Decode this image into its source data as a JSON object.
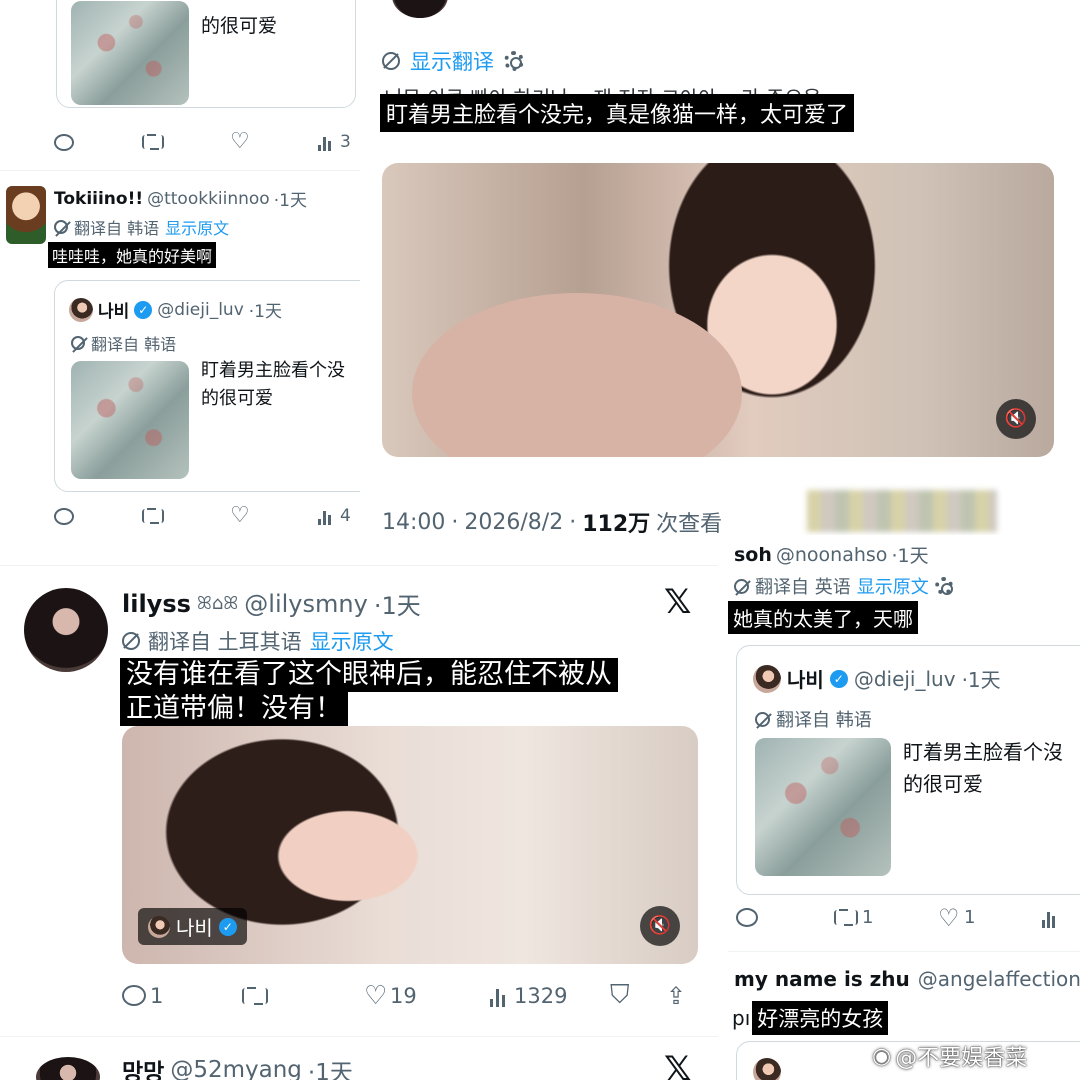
{
  "top_left": {
    "partial_text": "的很可爱",
    "second_tweet": {
      "name": "Tokiiino!!",
      "handle": "@ttookkiinnoo",
      "time": "·1天",
      "translated_from": "翻译自 韩语",
      "show_original": "显示原文",
      "text": "哇哇哇，她真的好美啊",
      "quote": {
        "name": "나비",
        "handle": "@dieji_luv",
        "time": "·1天",
        "translated_from": "翻译自 韩语",
        "text_line1": "盯着男主脸看个没",
        "text_line2": "的很可爱"
      }
    }
  },
  "main_tweet": {
    "show_translation": "显示翻译",
    "garbled_original": "너무 이쿠 빠아 하기나ㅠ 재 저자 그아아ㅠ 라 주으음",
    "translated_text": "盯着男主脸看个没完，真是像猫一样，太可爱了",
    "time": "14:00",
    "date": "2026/8/2",
    "views_count": "112万",
    "views_label": "次查看"
  },
  "lilyss_tweet": {
    "name": "lilyss",
    "name_deco": "ꕤ⌂ꕤ",
    "handle": "@lilysmny",
    "time": "·1天",
    "translated_from": "翻译自 土耳其语",
    "show_original": "显示原文",
    "text_line1": "没有谁在看了这个眼神后，能忍住不被从",
    "text_line2": "正道带偏！没有！",
    "video_tag_name": "나비",
    "actions": {
      "replies": "1",
      "likes": "19",
      "views": "1329"
    }
  },
  "soh_tweet": {
    "name": "soh",
    "handle": "@noonahso",
    "time": "·1天",
    "translated_from": "翻译自 英语",
    "show_original": "显示原文",
    "text": "她真的太美了，天哪",
    "quote": {
      "name": "나비",
      "handle": "@dieji_luv",
      "time": "·1天",
      "translated_from": "翻译自 韩语",
      "text_line1": "盯着男主脸看个沒",
      "text_line2": "的很可爱"
    },
    "actions": {
      "retweets": "1",
      "likes": "1"
    }
  },
  "zhu_tweet": {
    "name": "my name is zhu",
    "handle": "@angelaffection",
    "prefix": "pı",
    "text": "好漂亮的女孩"
  },
  "bottom_partial": {
    "name": "망망",
    "handle": "@52myang",
    "time": "·1天"
  },
  "watermark": "@不要娱香菜",
  "icons": {
    "reply": "reply-icon",
    "retweet": "retweet-icon",
    "like": "heart-icon",
    "views": "views-icon",
    "bookmark": "bookmark-icon",
    "share": "share-icon",
    "translate": "translate-icon",
    "settings": "gear-icon",
    "mute": "mute-icon",
    "x_logo": "x-logo-icon"
  }
}
